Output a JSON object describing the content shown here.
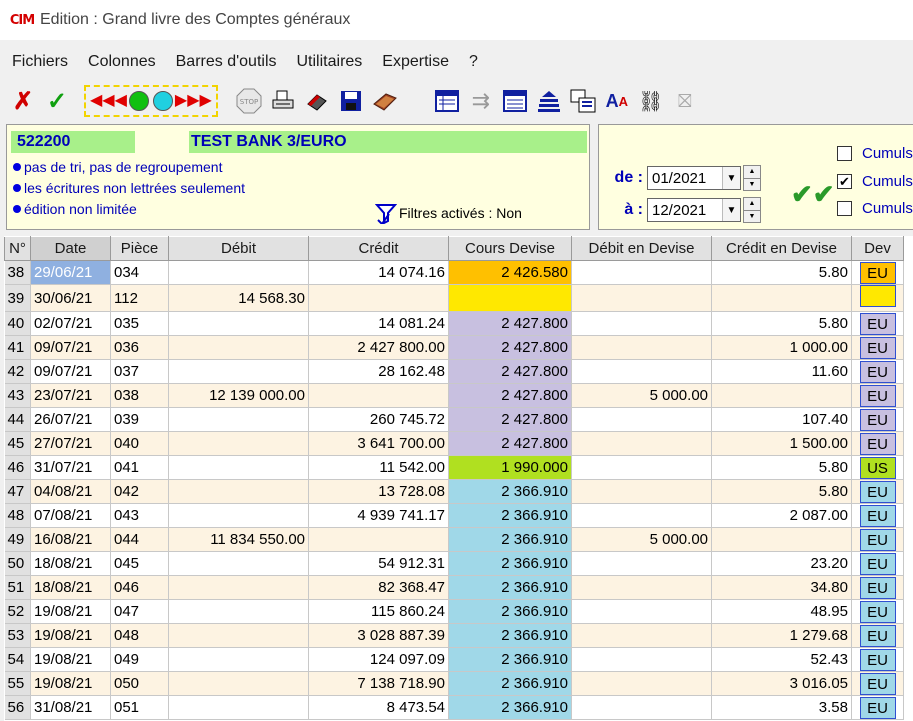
{
  "window": {
    "title": "Edition : Grand livre des Comptes généraux",
    "logo_text": "CIM"
  },
  "menu": [
    "Fichiers",
    "Colonnes",
    "Barres d'outils",
    "Utilitaires",
    "Expertise",
    "?"
  ],
  "toolbar_icons": [
    "cancel-icon",
    "validate-icon",
    "first-record-icon",
    "previous-record-icon",
    "green-record-icon",
    "cyan-record-icon",
    "next-record-icon",
    "last-record-icon",
    "stop-icon",
    "print-icon",
    "eraser-icon",
    "save-icon",
    "book-icon",
    "columns-icon",
    "export-icon",
    "list-icon",
    "sort-icon",
    "tree-view-icon",
    "font-icon",
    "link-icon",
    "exit-icon"
  ],
  "account": {
    "code": "522200",
    "name": "TEST BANK 3/EURO",
    "options": [
      "pas de tri, pas de regroupement",
      "les écritures non lettrées seulement",
      "édition non limitée"
    ],
    "filters": "Filtres activés : Non"
  },
  "period": {
    "from_label": "de :",
    "from_value": "01/2021",
    "to_label": "à :",
    "to_value": "12/2021"
  },
  "cumuls": [
    {
      "label": "Cumuls",
      "checked": false
    },
    {
      "label": "Cumuls",
      "checked": true
    },
    {
      "label": "Cumuls",
      "checked": false
    }
  ],
  "columns": [
    "N°",
    "Date",
    "Pièce",
    "Débit",
    "Crédit",
    "Cours Devise",
    "Débit en Devise",
    "Crédit en Devise",
    "Dev"
  ],
  "colors": {
    "rate_orange": "#ffc000",
    "rate_yellow": "#ffe800",
    "rate_lavender": "#c8c0e0",
    "rate_green": "#b0e020",
    "rate_blue": "#a0d8e8",
    "dev_orange": "#ffc000",
    "dev_yellow": "#ffe800",
    "dev_lavender": "#c8c0e0",
    "dev_green": "#b0e020",
    "dev_blue": "#a0d8e8"
  },
  "rows": [
    {
      "n": "38",
      "date": "29/06/21",
      "piece": "034",
      "debit": "",
      "credit": "14 074.16",
      "rate": "2 426.580",
      "debit_dev": "",
      "credit_dev": "5.80",
      "dev": "EU",
      "rate_color": "orange",
      "dev_color": "orange"
    },
    {
      "n": "39",
      "date": "30/06/21",
      "piece": "112",
      "debit": "14 568.30",
      "credit": "",
      "rate": "",
      "debit_dev": "",
      "credit_dev": "",
      "dev": "",
      "rate_color": "yellow",
      "dev_color": "yellow"
    },
    {
      "n": "40",
      "date": "02/07/21",
      "piece": "035",
      "debit": "",
      "credit": "14 081.24",
      "rate": "2 427.800",
      "debit_dev": "",
      "credit_dev": "5.80",
      "dev": "EU",
      "rate_color": "lavender",
      "dev_color": "lavender"
    },
    {
      "n": "41",
      "date": "09/07/21",
      "piece": "036",
      "debit": "",
      "credit": "2 427 800.00",
      "rate": "2 427.800",
      "debit_dev": "",
      "credit_dev": "1 000.00",
      "dev": "EU",
      "rate_color": "lavender",
      "dev_color": "lavender"
    },
    {
      "n": "42",
      "date": "09/07/21",
      "piece": "037",
      "debit": "",
      "credit": "28 162.48",
      "rate": "2 427.800",
      "debit_dev": "",
      "credit_dev": "11.60",
      "dev": "EU",
      "rate_color": "lavender",
      "dev_color": "lavender"
    },
    {
      "n": "43",
      "date": "23/07/21",
      "piece": "038",
      "debit": "12 139 000.00",
      "credit": "",
      "rate": "2 427.800",
      "debit_dev": "5 000.00",
      "credit_dev": "",
      "dev": "EU",
      "rate_color": "lavender",
      "dev_color": "lavender"
    },
    {
      "n": "44",
      "date": "26/07/21",
      "piece": "039",
      "debit": "",
      "credit": "260 745.72",
      "rate": "2 427.800",
      "debit_dev": "",
      "credit_dev": "107.40",
      "dev": "EU",
      "rate_color": "lavender",
      "dev_color": "lavender"
    },
    {
      "n": "45",
      "date": "27/07/21",
      "piece": "040",
      "debit": "",
      "credit": "3 641 700.00",
      "rate": "2 427.800",
      "debit_dev": "",
      "credit_dev": "1 500.00",
      "dev": "EU",
      "rate_color": "lavender",
      "dev_color": "lavender"
    },
    {
      "n": "46",
      "date": "31/07/21",
      "piece": "041",
      "debit": "",
      "credit": "11 542.00",
      "rate": "1 990.000",
      "debit_dev": "",
      "credit_dev": "5.80",
      "dev": "US",
      "rate_color": "green",
      "dev_color": "green"
    },
    {
      "n": "47",
      "date": "04/08/21",
      "piece": "042",
      "debit": "",
      "credit": "13 728.08",
      "rate": "2 366.910",
      "debit_dev": "",
      "credit_dev": "5.80",
      "dev": "EU",
      "rate_color": "blue",
      "dev_color": "blue"
    },
    {
      "n": "48",
      "date": "07/08/21",
      "piece": "043",
      "debit": "",
      "credit": "4 939 741.17",
      "rate": "2 366.910",
      "debit_dev": "",
      "credit_dev": "2 087.00",
      "dev": "EU",
      "rate_color": "blue",
      "dev_color": "blue"
    },
    {
      "n": "49",
      "date": "16/08/21",
      "piece": "044",
      "debit": "11 834 550.00",
      "credit": "",
      "rate": "2 366.910",
      "debit_dev": "5 000.00",
      "credit_dev": "",
      "dev": "EU",
      "rate_color": "blue",
      "dev_color": "blue"
    },
    {
      "n": "50",
      "date": "18/08/21",
      "piece": "045",
      "debit": "",
      "credit": "54 912.31",
      "rate": "2 366.910",
      "debit_dev": "",
      "credit_dev": "23.20",
      "dev": "EU",
      "rate_color": "blue",
      "dev_color": "blue"
    },
    {
      "n": "51",
      "date": "18/08/21",
      "piece": "046",
      "debit": "",
      "credit": "82 368.47",
      "rate": "2 366.910",
      "debit_dev": "",
      "credit_dev": "34.80",
      "dev": "EU",
      "rate_color": "blue",
      "dev_color": "blue"
    },
    {
      "n": "52",
      "date": "19/08/21",
      "piece": "047",
      "debit": "",
      "credit": "115 860.24",
      "rate": "2 366.910",
      "debit_dev": "",
      "credit_dev": "48.95",
      "dev": "EU",
      "rate_color": "blue",
      "dev_color": "blue"
    },
    {
      "n": "53",
      "date": "19/08/21",
      "piece": "048",
      "debit": "",
      "credit": "3 028 887.39",
      "rate": "2 366.910",
      "debit_dev": "",
      "credit_dev": "1 279.68",
      "dev": "EU",
      "rate_color": "blue",
      "dev_color": "blue"
    },
    {
      "n": "54",
      "date": "19/08/21",
      "piece": "049",
      "debit": "",
      "credit": "124 097.09",
      "rate": "2 366.910",
      "debit_dev": "",
      "credit_dev": "52.43",
      "dev": "EU",
      "rate_color": "blue",
      "dev_color": "blue"
    },
    {
      "n": "55",
      "date": "19/08/21",
      "piece": "050",
      "debit": "",
      "credit": "7 138 718.90",
      "rate": "2 366.910",
      "debit_dev": "",
      "credit_dev": "3 016.05",
      "dev": "EU",
      "rate_color": "blue",
      "dev_color": "blue"
    },
    {
      "n": "56",
      "date": "31/08/21",
      "piece": "051",
      "debit": "",
      "credit": "8 473.54",
      "rate": "2 366.910",
      "debit_dev": "",
      "credit_dev": "3.58",
      "dev": "EU",
      "rate_color": "blue",
      "dev_color": "blue"
    }
  ],
  "selected_row_index": 0
}
